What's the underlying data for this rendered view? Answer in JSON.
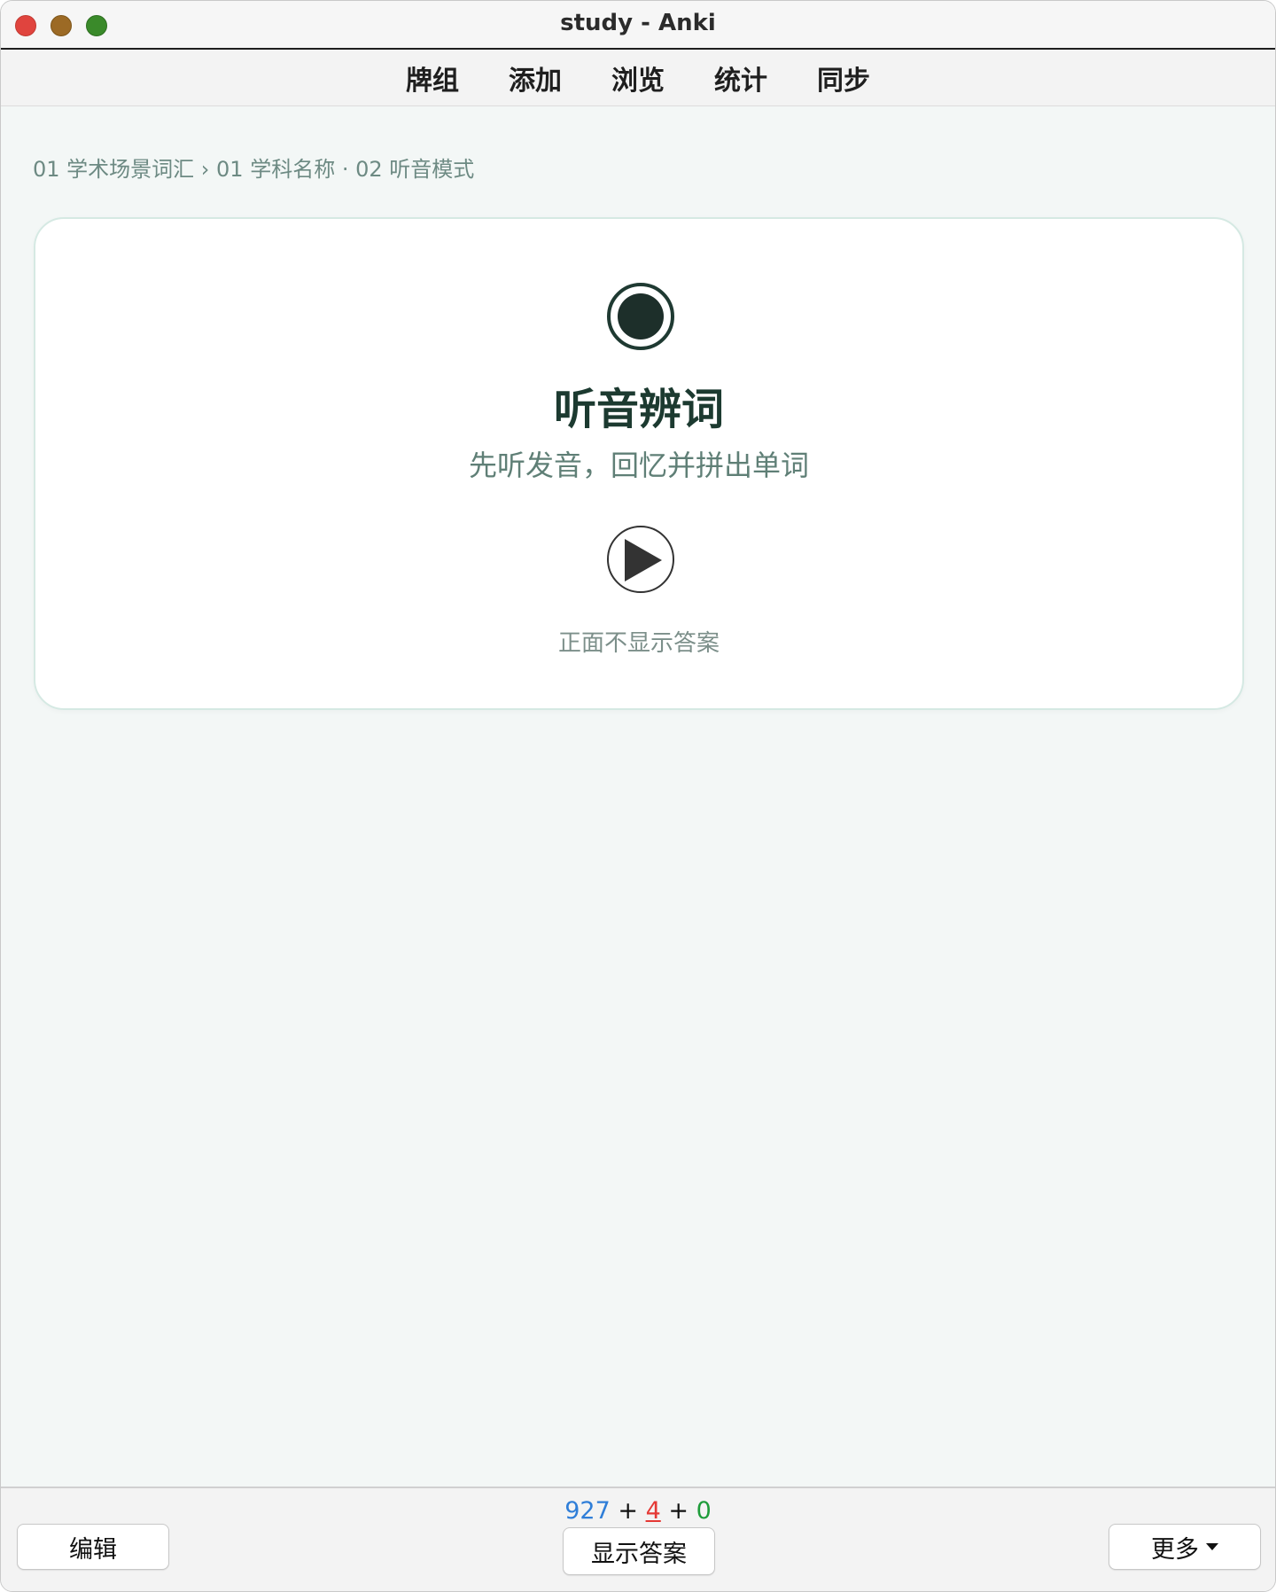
{
  "window": {
    "title": "study - Anki"
  },
  "nav": {
    "items": [
      "牌组",
      "添加",
      "浏览",
      "统计",
      "同步"
    ]
  },
  "breadcrumb": "01 学术场景词汇 › 01 学科名称 · 02 听音模式",
  "card": {
    "title": "听音辨词",
    "subtitle": "先听发音，回忆并拼出单词",
    "note": "正面不显示答案",
    "record_icon": "record-icon",
    "play_icon": "play-icon"
  },
  "bottom": {
    "counts": {
      "new": "927",
      "learn": "4",
      "review": "0",
      "separator": "+"
    },
    "edit_label": "编辑",
    "show_answer_label": "显示答案",
    "more_label": "更多"
  },
  "colors": {
    "accent_dark": "#1c3a30",
    "count_new": "#2f7ed8",
    "count_learn": "#e53935",
    "count_review": "#1e9c3a"
  }
}
